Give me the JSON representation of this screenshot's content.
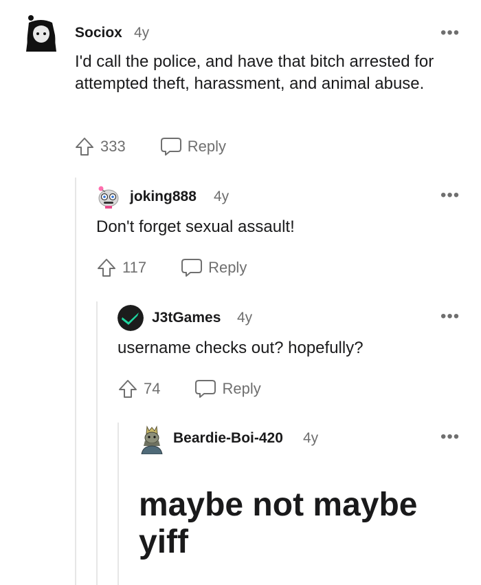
{
  "colors": {
    "text": "#1a1a1b",
    "meta": "#6f6f6f",
    "thread_line": "#e6e6e6",
    "j3t_accent": "#1fd6a0"
  },
  "comments": [
    {
      "username": "Sociox",
      "age": "4y",
      "more_icon": "more-horizontal-icon",
      "text": "I'd call the police, and have that bitch arrested for attempted theft, harassment, and animal abuse.",
      "votes": "333",
      "reply_label": "Reply"
    },
    {
      "username": "joking888",
      "age": "4y",
      "more_icon": "more-horizontal-icon",
      "text": "Don't forget sexual assault!",
      "votes": "117",
      "reply_label": "Reply"
    },
    {
      "username": "J3tGames",
      "age": "4y",
      "more_icon": "more-horizontal-icon",
      "text": "username checks out? hopefully?",
      "votes": "74",
      "reply_label": "Reply"
    },
    {
      "username": "Beardie-Boi-420",
      "age": "4y",
      "more_icon": "more-horizontal-icon",
      "text": "maybe not maybe yiff"
    }
  ]
}
